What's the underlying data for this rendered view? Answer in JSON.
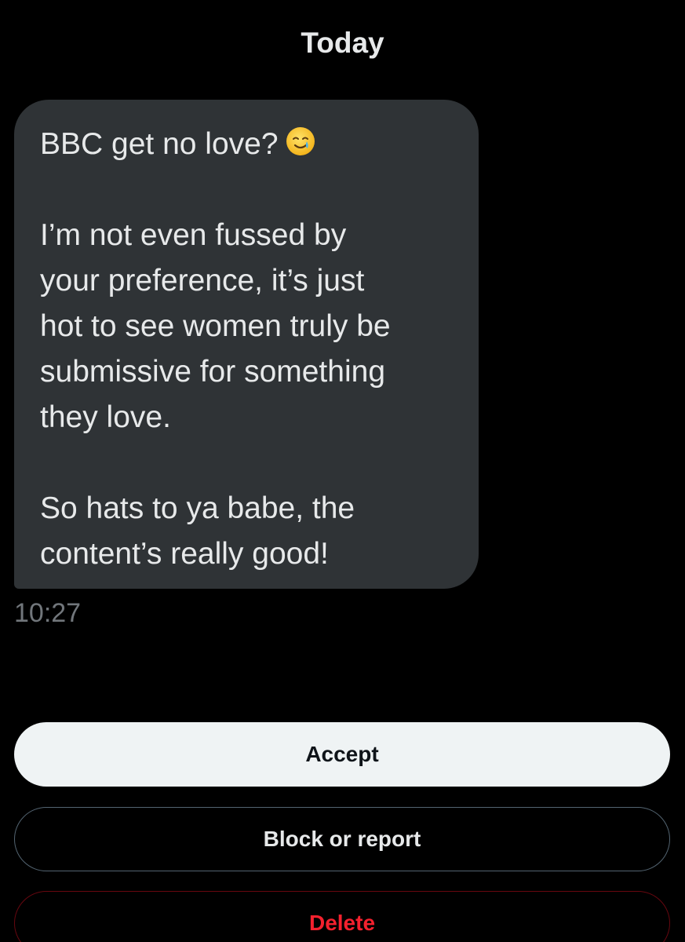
{
  "conversation": {
    "date_header": "Today"
  },
  "message": {
    "first_line": "BBC get no love?",
    "emoji_icon": "smiling-face-with-tear",
    "paragraph_2": "I’m not even fussed by\nyour preference, it’s just\nhot to see women truly be\nsubmissive for something\nthey love.",
    "paragraph_3": "So hats to ya babe, the\ncontent’s really good!",
    "timestamp": "10:27",
    "bubble_color": "#2f3336"
  },
  "actions": {
    "accept_label": "Accept",
    "block_label": "Block or report",
    "delete_label": "Delete",
    "delete_color": "#f4212e"
  }
}
